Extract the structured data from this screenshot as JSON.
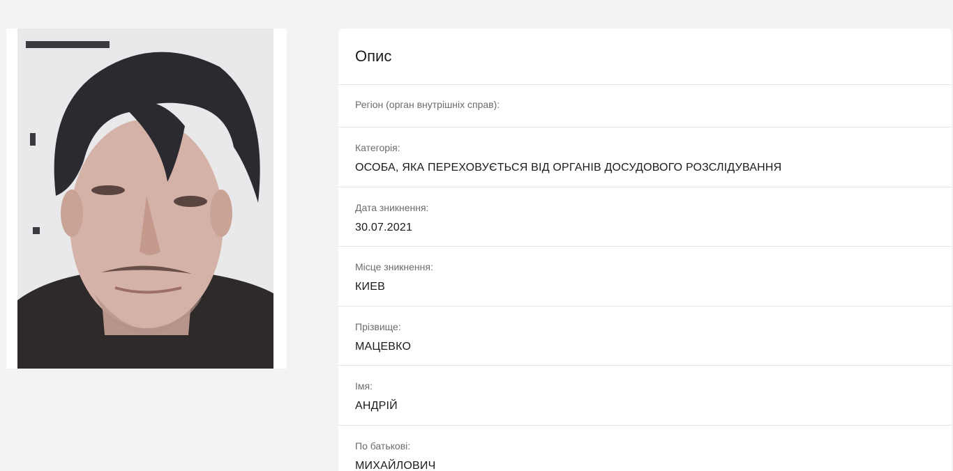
{
  "card": {
    "title": "Опис"
  },
  "fields": [
    {
      "label": "Регіон (орган внутрішніх справ):",
      "value": ""
    },
    {
      "label": "Категорія:",
      "value": "ОСОБА, ЯКА ПЕРЕХОВУЄТЬСЯ ВІД ОРГАНІВ ДОСУДОВОГО РОЗСЛІДУВАННЯ"
    },
    {
      "label": "Дата зникнення:",
      "value": "30.07.2021"
    },
    {
      "label": "Місце зникнення:",
      "value": "КИЕВ"
    },
    {
      "label": "Прізвище:",
      "value": "МАЦЕВКО"
    },
    {
      "label": "Імя:",
      "value": "АНДРІЙ"
    },
    {
      "label": "По батькові:",
      "value": "МИХАЙЛОВИЧ"
    }
  ],
  "colors": {
    "background": "#f3f3f3",
    "card": "#ffffff",
    "divider": "#e4e4e4",
    "label": "#6b6b6b",
    "value": "#1b1b1b"
  }
}
